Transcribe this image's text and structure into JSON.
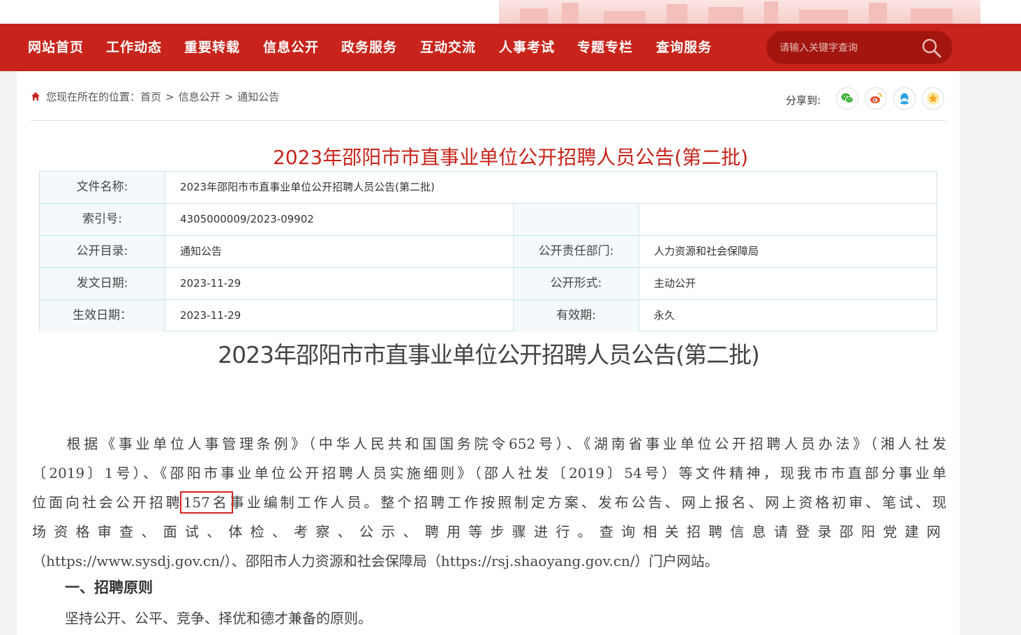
{
  "colors": {
    "brand_red": "#c8241b",
    "title_red": "#c8241b",
    "table_border": "#cfe4ec",
    "label_bg": "#f3f9fc",
    "highlight_box": "#d42424"
  },
  "nav": {
    "items": [
      "网站首页",
      "工作动态",
      "重要转载",
      "信息公开",
      "政务服务",
      "互动交流",
      "人事考试",
      "专题专栏",
      "查询服务"
    ],
    "search_placeholder": "请输入关键字查询",
    "search_icon": "search-icon"
  },
  "breadcrumb": {
    "prefix": "您现在所在的位置：",
    "items": [
      "首页",
      "信息公开",
      "通知公告"
    ],
    "separator": ">",
    "home_icon": "home-icon"
  },
  "share": {
    "label": "分享到:",
    "buttons": [
      {
        "icon": "wechat-icon",
        "color": "#3cb034"
      },
      {
        "icon": "weibo-icon",
        "color": "#e6512c"
      },
      {
        "icon": "qq-icon",
        "color": "#2b9fe6"
      },
      {
        "icon": "favorite-star-icon",
        "color": "#f4a820"
      }
    ]
  },
  "header_title": "2023年邵阳市市直事业单位公开招聘人员公告(第二批)",
  "meta": {
    "file_name_label": "文件名称:",
    "file_name": "2023年邵阳市市直事业单位公开招聘人员公告(第二批)",
    "index_label": "索引号:",
    "index_value": "4305000009/2023-09902",
    "index_extra_label": "",
    "index_extra_value": "",
    "catalog_label": "公开目录:",
    "catalog_value": "通知公告",
    "dept_label": "公开责任部门:",
    "dept_value": "人力资源和社会保障局",
    "issue_date_label": "发文日期:",
    "issue_date_value": "2023-11-29",
    "form_label": "公开形式:",
    "form_value": "主动公开",
    "effective_label": "生效日期：",
    "effective_value": "2023-11-29",
    "validity_label": "有效期:",
    "validity_value": "永久"
  },
  "article": {
    "title": "2023年邵阳市市直事业单位公开招聘人员公告(第二批)",
    "line1": "　　根据《事业单位人事管理条例》（中华人民共和国国务院令652号）、《湖南省事业单位公开招聘人员办法》（湘人社发",
    "line2": "〔2019〕1号）、《邵阳市事业单位公开招聘人员实施细则》（邵人社发〔2019〕54号）等文件精神，现我市市直部分事业单",
    "line3_pre": "位面向社会公开招聘",
    "line3_hl": "157名",
    "line3_post": "事业编制工作人员。整个招聘工作按照制定方案、发布公告、网上报名、网上资格初审、笔试、现",
    "line4": "场资格审查、面试、体检、考察、公示、聘用等步骤进行。查询相关招聘信息请登录邵阳党建网",
    "line5": "（https://www.sysdj.gov.cn/）、邵阳市人力资源和社会保障局（https://rsj.shaoyang.gov.cn/）门户网站。",
    "section1_heading": "一、招聘原则",
    "section1_text": "坚持公开、公平、竞争、择优和德才兼备的原则。"
  }
}
